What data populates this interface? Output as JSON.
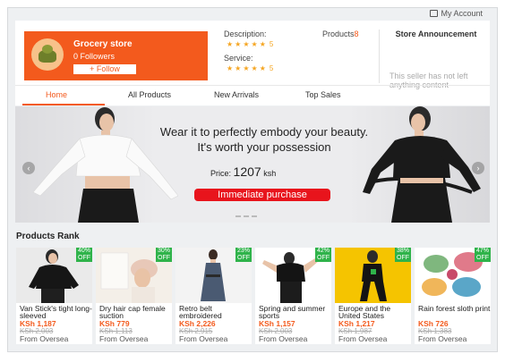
{
  "header": {
    "account_label": "My Account"
  },
  "store": {
    "name": "Grocery store",
    "followers": "0 Followers",
    "follow_label": "+ Follow",
    "description_label": "Description:",
    "service_label": "Service:",
    "description_rating": "5",
    "service_rating": "5",
    "products_label": "Products",
    "products_count": "8",
    "announcement_title": "Store Announcement",
    "announcement_body": "This seller has not left anything content"
  },
  "tabs": [
    {
      "label": "Home",
      "active": true
    },
    {
      "label": "All Products",
      "active": false
    },
    {
      "label": "New Arrivals",
      "active": false
    },
    {
      "label": "Top Sales",
      "active": false
    }
  ],
  "banner": {
    "headline": "Wear it to perfectly embody your beauty. It's worth your possession",
    "price_label": "Price:",
    "price_value": "1207",
    "price_unit": "ksh",
    "cta_label": "Immediate purchase",
    "prev_icon": "chevron-left-icon",
    "next_icon": "chevron-right-icon"
  },
  "products_rank": {
    "title": "Products Rank",
    "items": [
      {
        "name": "Van Stick's tight long-sleeved",
        "price": "KSh 1,187",
        "old_price": "KSh 2,003",
        "origin": "From Oversea",
        "discount": "40% OFF"
      },
      {
        "name": "Dry hair cap female suction",
        "price": "KSh 779",
        "old_price": "KSh 1,113",
        "origin": "From Oversea",
        "discount": "30% OFF"
      },
      {
        "name": "Retro belt embroidered",
        "price": "KSh 2,226",
        "old_price": "KSh 2,915",
        "origin": "From Oversea",
        "discount": "23% OFF"
      },
      {
        "name": "Spring and summer sports",
        "price": "KSh 1,157",
        "old_price": "KSh 2,003",
        "origin": "From Oversea",
        "discount": "42% OFF"
      },
      {
        "name": "Europe and the United States",
        "price": "KSh 1,217",
        "old_price": "KSh 1,987",
        "origin": "From Oversea",
        "discount": "38% OFF"
      },
      {
        "name": "Rain forest sloth print",
        "price": "KSh 726",
        "old_price": "KSh 1,383",
        "origin": "From Oversea",
        "discount": "47% OFF"
      }
    ]
  },
  "colors": {
    "accent": "#f35a1d",
    "badge": "#2fb34a",
    "cta": "#e8141c",
    "stars": "#f5a623"
  }
}
